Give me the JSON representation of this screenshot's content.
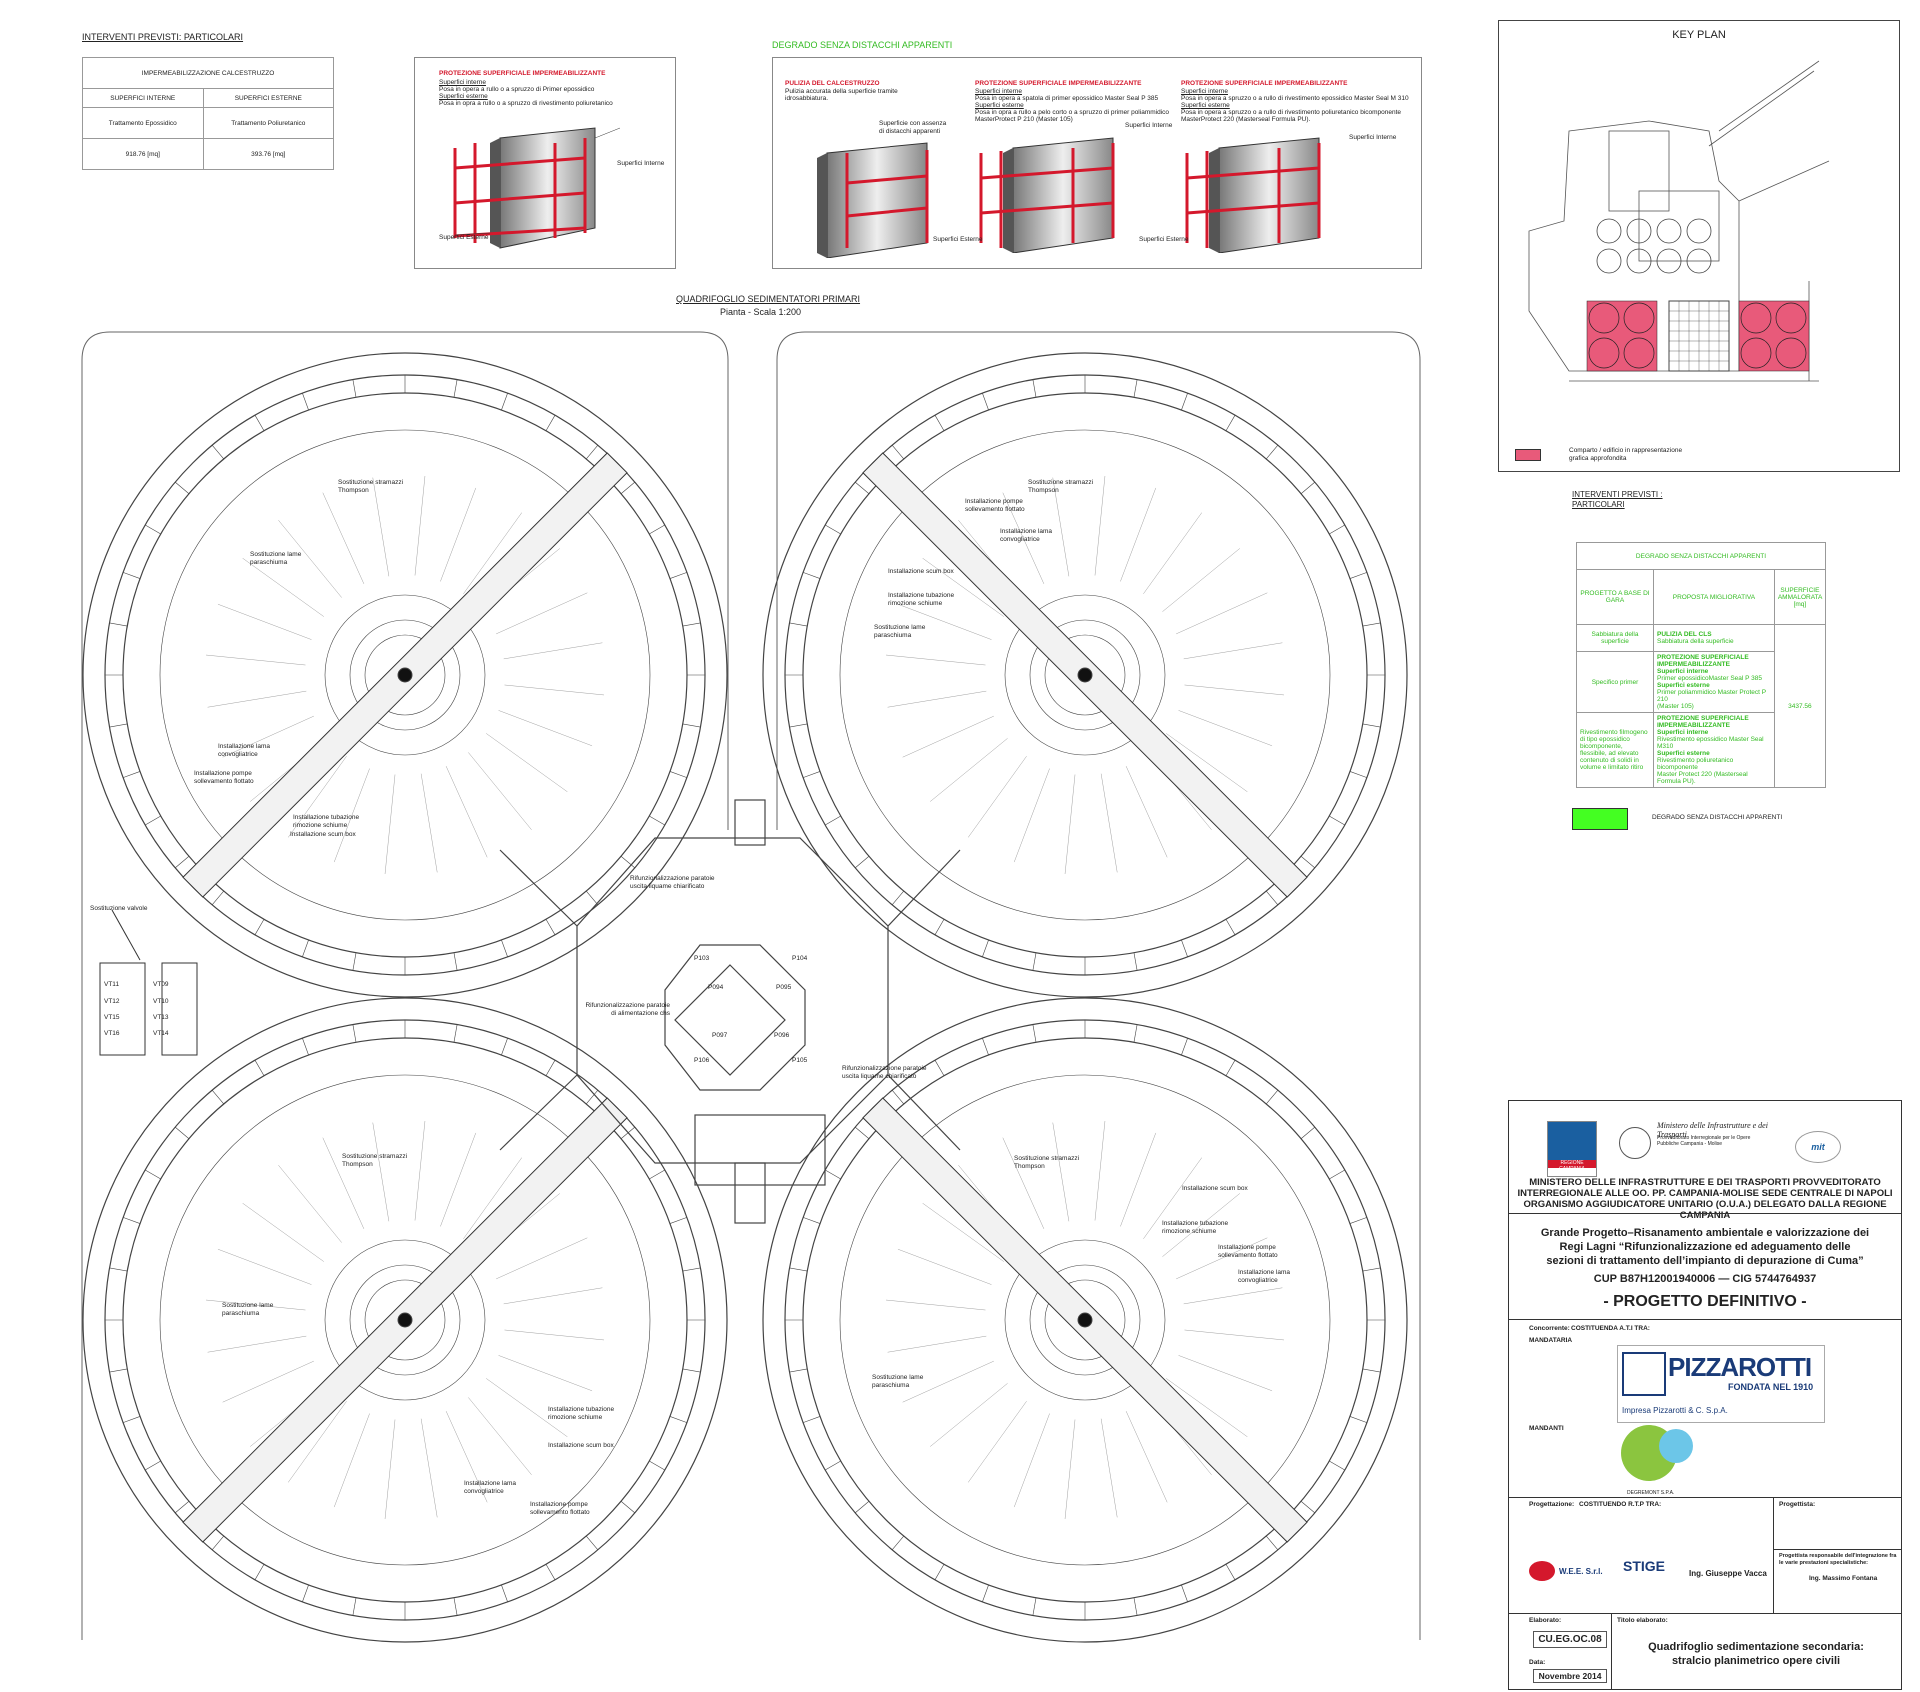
{
  "left_header": {
    "title": "INTERVENTI PREVISTI:  PARTICOLARI",
    "table": {
      "caption": "IMPERMEABILIZZAZIONE CALCESTRUZZO",
      "headers": [
        "SUPERFICI INTERNE",
        "SUPERFICI ESTERNE"
      ],
      "row1": [
        "Trattamento Epossidico",
        "Trattamento Poliuretanico"
      ],
      "row2": [
        "918.76 [mq]",
        "393.76 [mq]"
      ]
    }
  },
  "panel_left": {
    "title": "PROTEZIONE SUPERFICIALE IMPERMEABILIZZANTE",
    "lines": [
      "Superfici interne",
      "Posa in opera a rullo o a spruzzo di Primer epossidico",
      "Superfici esterne",
      "Posa in opra a rullo o a spruzzo di rivestimento poliuretanico"
    ],
    "label_int": "Superfici Interne",
    "label_ext": "Superfici Esterne"
  },
  "panel_degrado": {
    "title": "DEGRADO SENZA DISTACCHI APPARENTI",
    "col1": {
      "title": "PULIZIA DEL CALCESTRUZZO",
      "lines": [
        "Pulizia accurata della superficie  tramite",
        "idrosabbiatura."
      ],
      "label": "Superficie con assenza di distacchi apparenti"
    },
    "col2": {
      "title": "PROTEZIONE SUPERFICIALE IMPERMEABILIZZANTE",
      "lines": [
        "Superfici interne",
        "Posa in opera a spatola di primer epossidico Master Seal P 385",
        "Superfici esterne",
        "Posa in opra a rullo a pelo corto o a spruzzo di primer poliammidico",
        "MasterProtect P 210 (Master 105)"
      ],
      "label_int": "Superfici Interne",
      "label_ext": "Superfici Esterne"
    },
    "col3": {
      "title": "PROTEZIONE SUPERFICIALE IMPERMEABILIZZANTE",
      "lines": [
        "Superfici interne",
        "Posa in opera a spruzzo o a rullo di  rivestimento epossidico Master Seal M 310",
        "Superfici esterne",
        "Posa in opera a spruzzo o a rullo di  rivestimento poliuretanico bicomponente",
        "MasterProtect 220 (Masterseal Formula PU)."
      ],
      "label_int": "Superfici Interne",
      "label_ext": "Superfici Esterne"
    }
  },
  "plan": {
    "title": "QUADRIFOGLIO SEDIMENTATORI PRIMARI",
    "subtitle": "Pianta - Scala 1:200",
    "labels": {
      "stramazzi": "Sostituzione stramazzi Thompson",
      "lame": "Sostituzione lame paraschiuma",
      "lama_conv": "Installazione lama convogliatrice",
      "pompe": "Installazione pompe sollevamento flottato",
      "tubazione": "Installazione tubazione rimozione schiume",
      "scum": "Installazione scum box",
      "valvole": "Sostituzione valvole",
      "paratoie_uscita": "Rifunzionalizzazione paratoie uscita liquame chiarificato",
      "paratoie_alim": "Rifunzionalizzazione paratoie di alimentazione chs"
    },
    "valves_left": [
      "VT11",
      "VT12",
      "VT15",
      "VT16"
    ],
    "valves_right": [
      "VT09",
      "VT10",
      "VT13",
      "VT14"
    ],
    "gates": [
      "P103",
      "P104",
      "P106",
      "P105",
      "P094",
      "P095",
      "P097",
      "P096"
    ]
  },
  "key_plan": {
    "title": "KEY PLAN",
    "legend": "Comparto / edificio in rappresentazione grafica approfondita",
    "highlight_color": "#e85a7a"
  },
  "right_table": {
    "title_lines": [
      "INTERVENTI PREVISTI :",
      "PARTICOLARI"
    ],
    "caption": "DEGRADO SENZA DISTACCHI APPARENTI",
    "headers": [
      "PROGETTO A BASE DI GARA",
      "PROPOSTA MIGLIORATIVA",
      "SUPERFICIE AMMALORATA [mq]"
    ],
    "rows": [
      {
        "base": "Sabbiatura della superficie",
        "proposta": [
          "PULIZIA DEL CLS",
          "Sabbiatura della superficie"
        ]
      },
      {
        "base": "Specifico primer",
        "proposta": [
          "PROTEZIONE SUPERFICIALE IMPERMEABILIZZANTE",
          "Superfici interne",
          "Primer epossidicoMaster Seal P 385",
          "Superfici esterne",
          "Primer poliammidico Master Protect P 210",
          "(Master 105)"
        ]
      },
      {
        "base": "Rivestimento filmogeno di tipo epossidico bicomponente, flessibile, ad elevato contenuto di solidi in volume e limitato ritiro",
        "proposta": [
          "PROTEZIONE SUPERFICIALE IMPERMEABILIZZANTE",
          "Superfici interne",
          "Rivestimento epossidico Master Seal M310",
          "Superfici esterne",
          "Rivestimento poliuretanico bicomponente",
          "Master Protect 220  (Masterseal Formula PU)."
        ]
      }
    ],
    "surface": "3437.56",
    "legend": "DEGRADO SENZA DISTACCHI APPARENTI",
    "legend_color": "#44ff22"
  },
  "title_block": {
    "logo_campania": "REGIONE CAMPANIA",
    "logo_ministero": "Ministero delle Infrastrutture e dei Trasporti",
    "ministero_sub": "Provveditorato Interregionale per le Opere Pubbliche Campania - Molise",
    "logo_mit": "mit",
    "header_lines": [
      "MINISTERO DELLE INFRASTRUTTURE E DEI TRASPORTI PROVVEDITORATO",
      "INTERREGIONALE ALLE OO. PP. CAMPANIA-MOLISE SEDE CENTRALE DI NAPOLI",
      "ORGANISMO AGGIUDICATORE UNITARIO (O.U.A.) DELEGATO DALLA REGIONE CAMPANIA"
    ],
    "project_lines": [
      "Grande Progetto–Risanamento ambientale e valorizzazione dei",
      "Regi Lagni “Rifunzionalizzazione ed adeguamento delle",
      "sezioni di trattamento dell’impianto di depurazione di Cuma”"
    ],
    "cup": "CUP B87H12001940006 — CIG 5744764937",
    "fase": "- PROGETTO DEFINITIVO -",
    "concorrente_label": "Concorrente:",
    "concorrente": "COSTITUENDA A.T.I TRA:",
    "mandataria": "MANDATARIA",
    "pizzarotti": "PIZZAROTTI",
    "fondata": "FONDATA NEL 1910",
    "pizzarotti_sub": "Impresa Pizzarotti & C. S.p.A.",
    "mandanti": "MANDANTI",
    "degremont": "DEGREMONT S.P.A.",
    "progettazione_label": "Progettazione:",
    "progettazione": "COSTITUENDO R.T.P TRA:",
    "progettista_label": "Progettista:",
    "responsabile_label": "Progettista responsabile dell'integrazione fra le varie prestazioni specialistiche:",
    "responsabile": "Ing. Massimo Fontana",
    "wee": "W.E.E. S.r.l.",
    "stige": "STIGE",
    "vacca": "Ing. Giuseppe Vacca",
    "elaborato_label": "Elaborato:",
    "elaborato": "CU.EG.OC.08",
    "titolo_label": "Titolo elaborato:",
    "titolo": [
      "Quadrifoglio sedimentazione secondaria:",
      "stralcio planimetrico opere civili"
    ],
    "data_label": "Data:",
    "data": "Novembre 2014"
  }
}
